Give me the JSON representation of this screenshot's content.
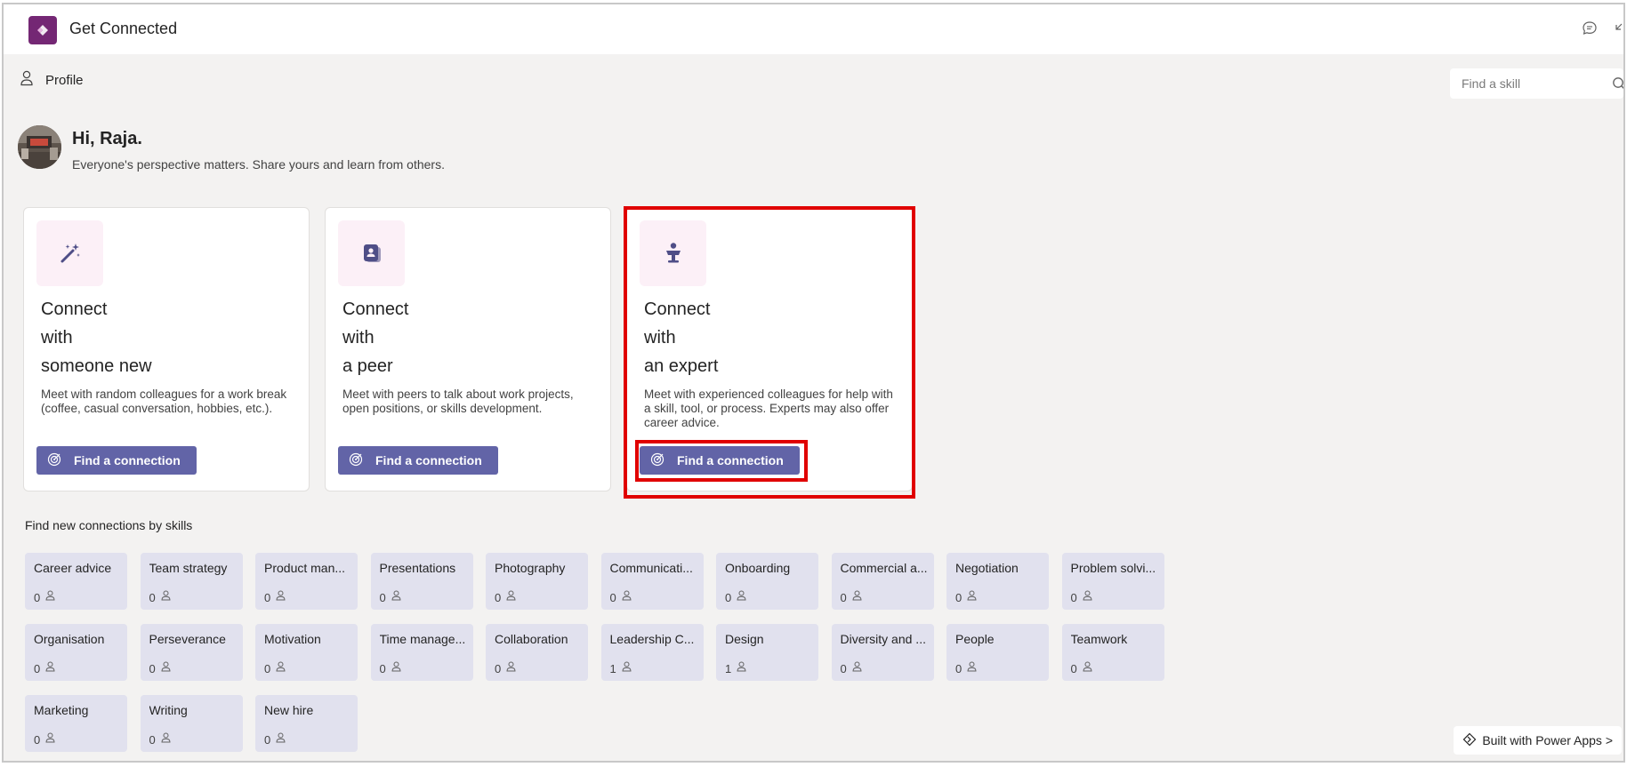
{
  "app": {
    "title": "Get Connected"
  },
  "toolbar": {
    "profile_label": "Profile",
    "search_placeholder": "Find a skill"
  },
  "greeting": {
    "title": "Hi, Raja.",
    "subtitle": "Everyone's perspective matters. Share yours and learn from others."
  },
  "cards": [
    {
      "title_lines": [
        "Connect",
        "with",
        "someone new"
      ],
      "description": "Meet with random colleagues for a work break (coffee, casual conversation, hobbies, etc.).",
      "button_label": "Find a connection",
      "icon": "magic-wand-icon"
    },
    {
      "title_lines": [
        "Connect",
        "with",
        "a peer"
      ],
      "description": "Meet with peers to talk about work projects, open positions, or skills development.",
      "button_label": "Find a connection",
      "icon": "contact-card-icon"
    },
    {
      "title_lines": [
        "Connect",
        "with",
        "an expert"
      ],
      "description": "Meet with experienced colleagues for help with a skill, tool, or process. Experts may also offer career advice.",
      "button_label": "Find a connection",
      "icon": "presenter-icon"
    }
  ],
  "skills_heading": "Find new connections by skills",
  "skills": [
    {
      "name": "Career advice",
      "count": "0"
    },
    {
      "name": "Team strategy",
      "count": "0"
    },
    {
      "name": "Product man...",
      "count": "0"
    },
    {
      "name": "Presentations",
      "count": "0"
    },
    {
      "name": "Photography",
      "count": "0"
    },
    {
      "name": "Communicati...",
      "count": "0"
    },
    {
      "name": "Onboarding",
      "count": "0"
    },
    {
      "name": "Commercial a...",
      "count": "0"
    },
    {
      "name": "Negotiation",
      "count": "0"
    },
    {
      "name": "Problem solvi...",
      "count": "0"
    },
    {
      "name": "Organisation",
      "count": "0"
    },
    {
      "name": "Perseverance",
      "count": "0"
    },
    {
      "name": "Motivation",
      "count": "0"
    },
    {
      "name": "Time manage...",
      "count": "0"
    },
    {
      "name": "Collaboration",
      "count": "0"
    },
    {
      "name": "Leadership C...",
      "count": "1"
    },
    {
      "name": "Design",
      "count": "1"
    },
    {
      "name": "Diversity and ...",
      "count": "0"
    },
    {
      "name": "People",
      "count": "0"
    },
    {
      "name": "Teamwork",
      "count": "0"
    },
    {
      "name": "Marketing",
      "count": "0"
    },
    {
      "name": "Writing",
      "count": "0"
    },
    {
      "name": "New hire",
      "count": "0"
    }
  ],
  "footer": {
    "powered_label": "Built with Power Apps >"
  },
  "colors": {
    "accent": "#6264a7",
    "brand": "#742774",
    "highlight": "#e00000",
    "tile": "#e1e1ee",
    "icon_bg": "#fcf0f7"
  }
}
